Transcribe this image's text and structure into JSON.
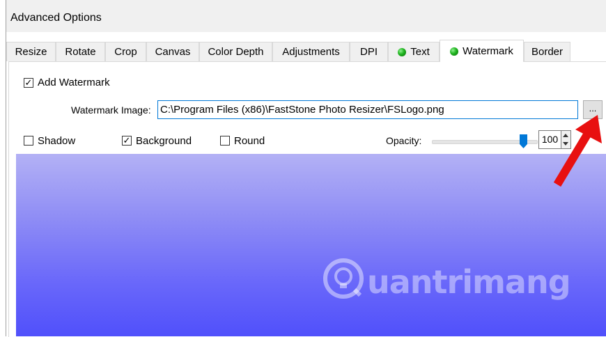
{
  "window": {
    "title": "Advanced Options"
  },
  "tabs": [
    {
      "label": "Resize",
      "dot": false
    },
    {
      "label": "Rotate",
      "dot": false
    },
    {
      "label": "Crop",
      "dot": false
    },
    {
      "label": "Canvas",
      "dot": false
    },
    {
      "label": "Color Depth",
      "dot": false
    },
    {
      "label": "Adjustments",
      "dot": false
    },
    {
      "label": "DPI",
      "dot": false
    },
    {
      "label": "Text",
      "dot": true
    },
    {
      "label": "Watermark",
      "dot": true,
      "active": true
    },
    {
      "label": "Border",
      "dot": false
    }
  ],
  "watermark": {
    "add_label": "Add Watermark",
    "add_checked": true,
    "image_label": "Watermark Image:",
    "image_path": "C:\\Program Files (x86)\\FastStone Photo Resizer\\FSLogo.png",
    "browse_label": "..."
  },
  "options": {
    "shadow_label": "Shadow",
    "shadow_checked": false,
    "background_label": "Background",
    "background_checked": true,
    "round_label": "Round",
    "round_checked": false
  },
  "opacity": {
    "label": "Opacity:",
    "value": "100",
    "fraction": 1.0
  },
  "preview": {
    "watermark_text": "uantrimang",
    "icon": "lightbulb-logo-icon"
  },
  "colors": {
    "accent": "#0078d7",
    "annotation_arrow": "#e81010",
    "preview_top": "#b3b1f5",
    "preview_bottom": "#5050fb"
  }
}
